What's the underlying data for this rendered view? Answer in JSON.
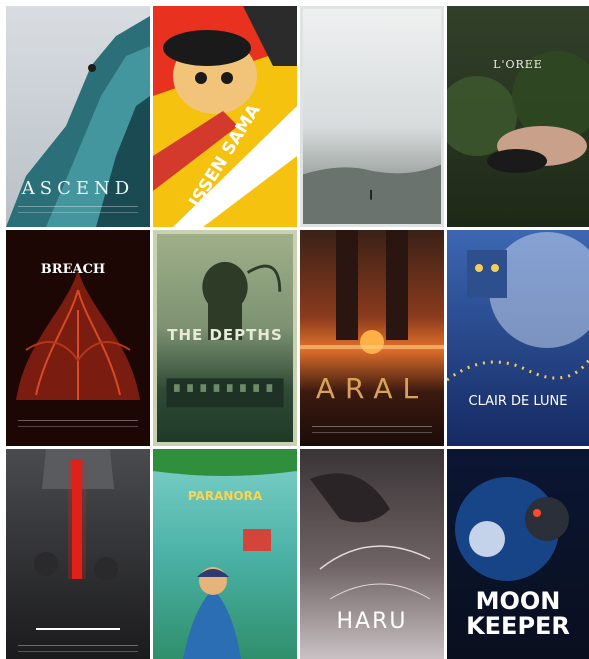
{
  "posters": [
    {
      "title": "ASCEND"
    },
    {
      "title": "ISSEN SAMA"
    },
    {
      "title": ""
    },
    {
      "title": "L'OREE"
    },
    {
      "title": "BREACH"
    },
    {
      "title": "THE DEPTHS"
    },
    {
      "title": "ARAL"
    },
    {
      "title": "CLAIR DE LUNE"
    },
    {
      "title": ""
    },
    {
      "title": "PARANORA"
    },
    {
      "title": "HARU"
    },
    {
      "title": "MOON KEEPER"
    }
  ]
}
